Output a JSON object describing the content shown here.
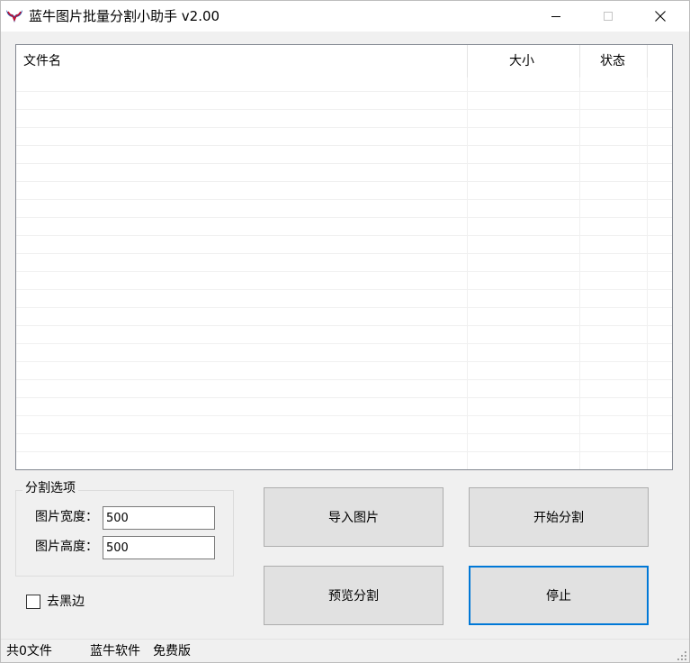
{
  "window": {
    "title": "蓝牛图片批量分割小助手 v2.00"
  },
  "file_list": {
    "columns": [
      {
        "label": "文件名"
      },
      {
        "label": "大小"
      },
      {
        "label": "状态"
      }
    ],
    "rows": []
  },
  "options": {
    "group_title": "分割选项",
    "width_label": "图片宽度：",
    "width_value": "500",
    "height_label": "图片高度：",
    "height_value": "500",
    "remove_black_border_label": "去黑边",
    "remove_black_border_checked": false
  },
  "buttons": {
    "import": "导入图片",
    "start": "开始分割",
    "preview": "预览分割",
    "stop": "停止"
  },
  "status_bar": {
    "file_count": "共0文件",
    "brand": "蓝牛软件",
    "edition": "免费版"
  },
  "colors": {
    "focus_border": "#0078d7",
    "button_face": "#e1e1e1",
    "icon_red": "#c8102e",
    "icon_blue": "#1f4fa8"
  }
}
